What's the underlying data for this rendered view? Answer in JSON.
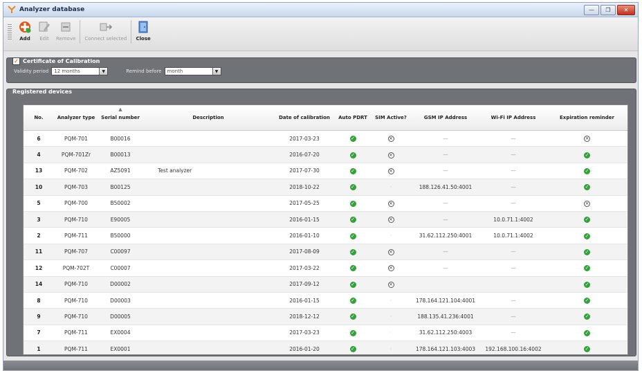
{
  "window": {
    "title": "Analyzer database",
    "btn_minimize": "—",
    "btn_restore": "❐",
    "btn_close": "✕"
  },
  "toolbar": {
    "add": "Add",
    "edit": "Edit",
    "remove": "Remove",
    "connect": "Connect selected",
    "close": "Close"
  },
  "certificate": {
    "title": "Certificate of Calibration",
    "validity_label": "Validity period",
    "validity_value": "12 months",
    "remind_label": "Remind before",
    "remind_value": "month"
  },
  "registered": {
    "title": "Registered devices"
  },
  "table": {
    "columns": [
      "No.",
      "Analyzer type",
      "Serial number",
      "Description",
      "Date of calibration",
      "Auto PDRT",
      "SIM Active?",
      "GSM IP Address",
      "Wi-Fi IP Address",
      "Expiration reminder"
    ],
    "sort_indicator": "▲",
    "rows": [
      {
        "no": "6",
        "type": "PQM-701",
        "serial": "B00016",
        "desc": "",
        "date": "2017-03-23",
        "auto": "ok",
        "sim": "no",
        "gsm": "—",
        "wifi": "—",
        "exp": "no"
      },
      {
        "no": "4",
        "type": "PQM-701Zr",
        "serial": "B00013",
        "desc": "",
        "date": "2016-07-20",
        "auto": "ok",
        "sim": "no",
        "gsm": "—",
        "wifi": "—",
        "exp": "ok"
      },
      {
        "no": "13",
        "type": "PQM-702",
        "serial": "AZ5091",
        "desc": "Test analyzer",
        "date": "2017-07-30",
        "auto": "ok",
        "sim": "no",
        "gsm": "—",
        "wifi": "—",
        "exp": "ok"
      },
      {
        "no": "10",
        "type": "PQM-703",
        "serial": "B00125",
        "desc": "",
        "date": "2018-10-22",
        "auto": "ok",
        "sim": "",
        "gsm": "188.126.41.50:4001",
        "wifi": "—",
        "exp": "ok"
      },
      {
        "no": "5",
        "type": "PQM-700",
        "serial": "B50002",
        "desc": "",
        "date": "2017-05-25",
        "auto": "ok",
        "sim": "no",
        "gsm": "—",
        "wifi": "—",
        "exp": "no"
      },
      {
        "no": "3",
        "type": "PQM-710",
        "serial": "E90005",
        "desc": "",
        "date": "2016-01-15",
        "auto": "ok",
        "sim": "no",
        "gsm": "—",
        "wifi": "10.0.71.1:4002",
        "exp": "ok"
      },
      {
        "no": "2",
        "type": "PQM-711",
        "serial": "B50000",
        "desc": "",
        "date": "2016-01-10",
        "auto": "ok",
        "sim": "",
        "gsm": "31.62.112.250:4001",
        "wifi": "10.0.71.1:4002",
        "exp": "ok"
      },
      {
        "no": "11",
        "type": "PQM-707",
        "serial": "C00097",
        "desc": "",
        "date": "2017-08-09",
        "auto": "ok",
        "sim": "no",
        "gsm": "—",
        "wifi": "—",
        "exp": "ok"
      },
      {
        "no": "12",
        "type": "PQM-702T",
        "serial": "C00007",
        "desc": "",
        "date": "2017-03-22",
        "auto": "ok",
        "sim": "no",
        "gsm": "—",
        "wifi": "—",
        "exp": "ok"
      },
      {
        "no": "14",
        "type": "PQM-710",
        "serial": "D00002",
        "desc": "",
        "date": "2017-09-12",
        "auto": "ok",
        "sim": "no",
        "gsm": "",
        "wifi": "",
        "exp": "ok"
      },
      {
        "no": "8",
        "type": "PQM-710",
        "serial": "D00003",
        "desc": "",
        "date": "2016-01-15",
        "auto": "ok",
        "sim": "",
        "gsm": "178.164.121.104:4001",
        "wifi": "—",
        "exp": "ok"
      },
      {
        "no": "9",
        "type": "PQM-710",
        "serial": "D00005",
        "desc": "",
        "date": "2018-12-12",
        "auto": "ok",
        "sim": "",
        "gsm": "188.135.41.236:4001",
        "wifi": "—",
        "exp": "ok"
      },
      {
        "no": "7",
        "type": "PQM-711",
        "serial": "EX0004",
        "desc": "",
        "date": "2017-03-23",
        "auto": "ok",
        "sim": "",
        "gsm": "31.62.112.250:4003",
        "wifi": "—",
        "exp": "ok"
      },
      {
        "no": "1",
        "type": "PQM-711",
        "serial": "EX0001",
        "desc": "",
        "date": "2016-01-20",
        "auto": "ok",
        "sim": "",
        "gsm": "178.164.121.103:4003",
        "wifi": "192.168.100.16:4002",
        "exp": "ok"
      }
    ]
  },
  "colors": {
    "ok": "#36a03c",
    "panel": "#6f7378",
    "add_icon": "#e0561b"
  }
}
